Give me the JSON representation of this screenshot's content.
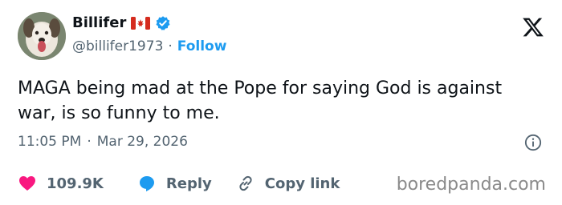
{
  "author": {
    "display_name": "Billifer",
    "handle": "@billifer1973",
    "separator": "·",
    "follow_label": "Follow"
  },
  "tweet": {
    "text": "MAGA being mad at the Pope for saying God is against war, is so funny to me.",
    "time": "11:05 PM",
    "separator": "·",
    "date": "Mar 29, 2026"
  },
  "actions": {
    "likes_count": "109.9K",
    "reply_label": "Reply",
    "copy_link_label": "Copy link"
  },
  "watermark": "boredpanda.com",
  "colors": {
    "accent_blue": "#1d9bf0",
    "heart_red": "#f91880",
    "muted_gray": "#536471",
    "text_dark": "#0f1419",
    "flag_red": "#d52b1e"
  },
  "icons": [
    "avatar-dog-photo",
    "canada-flag-icon",
    "verified-badge-icon",
    "x-logo-icon",
    "info-icon",
    "heart-icon",
    "reply-bubble-icon",
    "link-icon"
  ]
}
